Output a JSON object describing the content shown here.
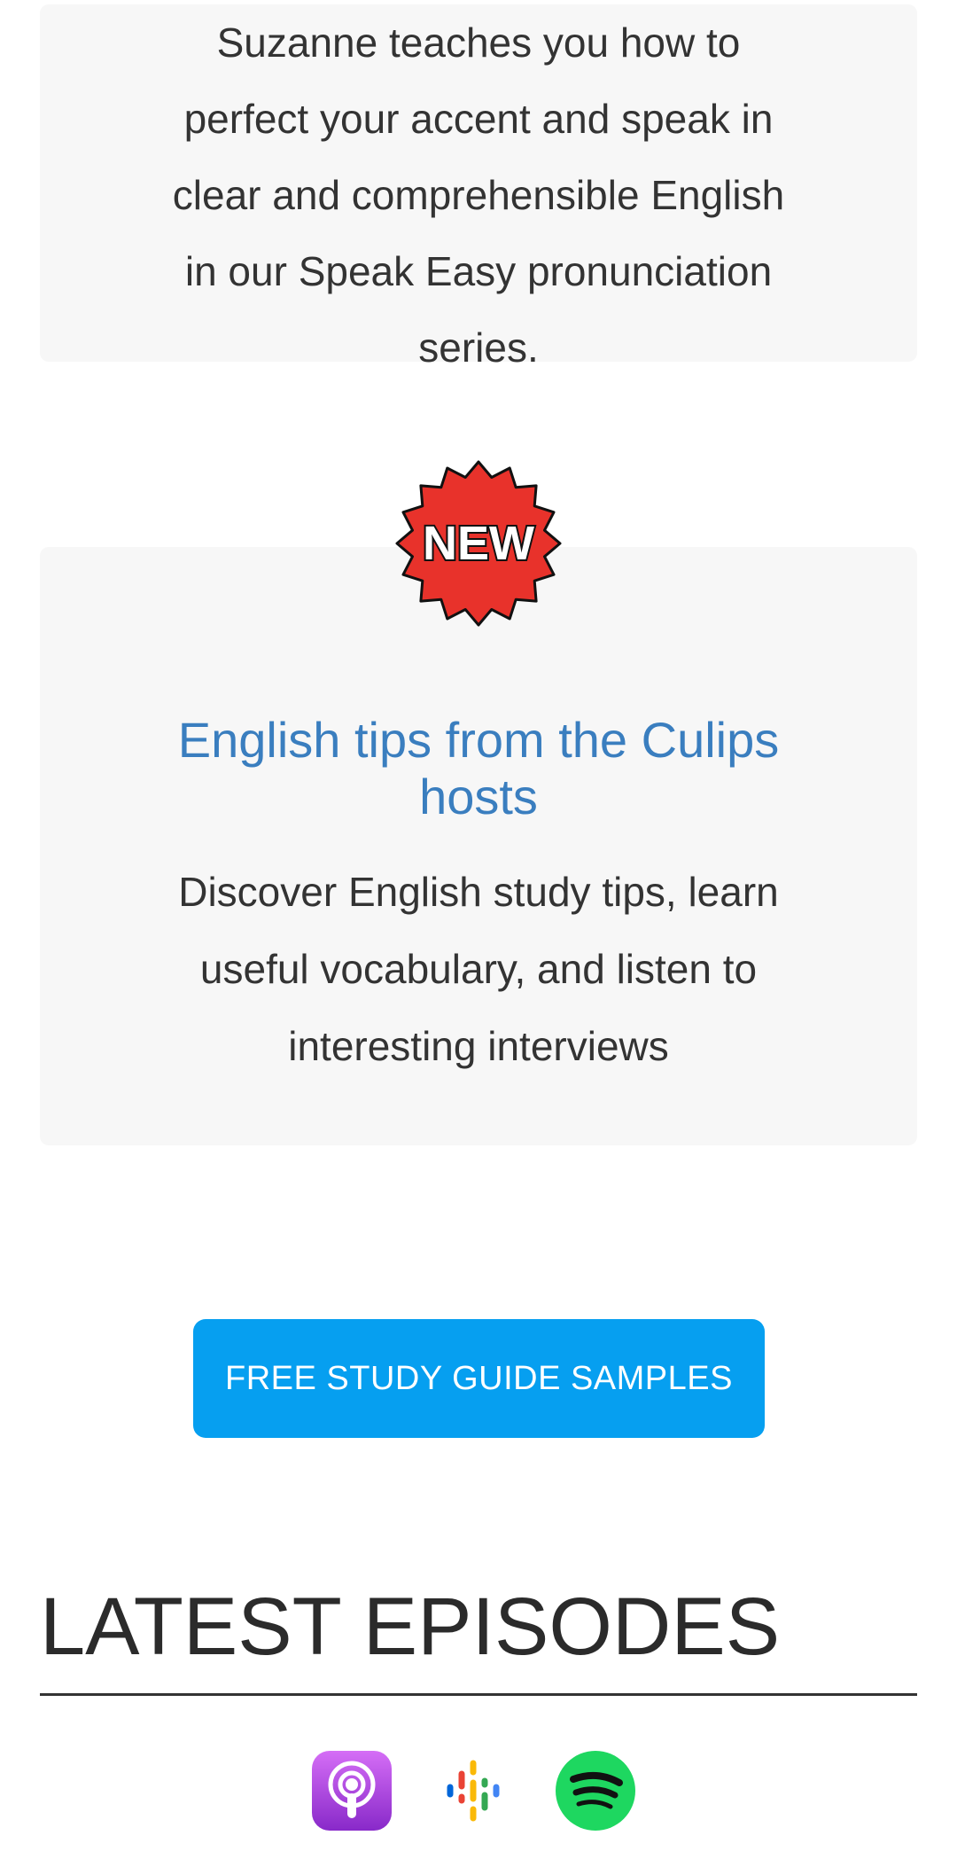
{
  "speak_easy": {
    "description": "Suzanne teaches you how to perfect your accent and speak in clear and comprehensible English in our Speak Easy pronunciation series."
  },
  "culips_tips": {
    "badge_text": "NEW",
    "title": "English tips from the Culips hosts",
    "description": "Discover English study tips, learn useful vocabulary, and listen to interesting interviews"
  },
  "cta": {
    "label": "FREE STUDY GUIDE SAMPLES",
    "color": "#069ff0"
  },
  "latest_episodes": {
    "heading": "LATEST EPISODES",
    "platforms": [
      {
        "icon": "apple-podcasts-icon"
      },
      {
        "icon": "google-podcasts-icon"
      },
      {
        "icon": "spotify-icon"
      }
    ]
  },
  "colors": {
    "card_bg": "#f7f7f7",
    "title_blue": "#3a7ebf",
    "badge_red": "#e8322b",
    "spotify_green": "#1ed760"
  }
}
